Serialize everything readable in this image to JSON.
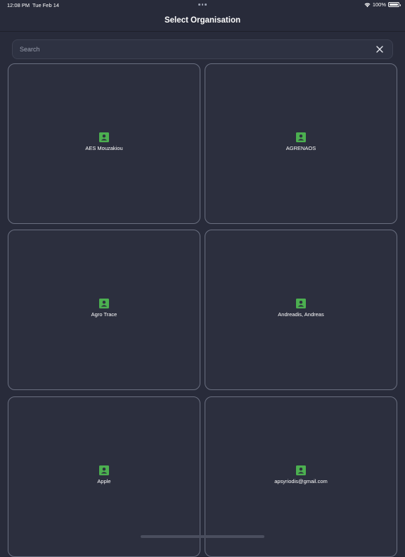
{
  "status_bar": {
    "time": "12:08 PM",
    "date": "Tue Feb 14",
    "battery": "100%",
    "wifi_icon": "wifi-icon",
    "battery_icon": "battery-icon"
  },
  "nav": {
    "title": "Select Organisation"
  },
  "search": {
    "placeholder": "Search",
    "value": "",
    "clear_icon": "close-icon"
  },
  "organisations": [
    {
      "name": "AES Mouzakiou",
      "icon": "contact-card-icon"
    },
    {
      "name": "AGRENAOS",
      "icon": "contact-card-icon"
    },
    {
      "name": "Agro Trace",
      "icon": "contact-card-icon"
    },
    {
      "name": "Andreadis, Andreas",
      "icon": "contact-card-icon"
    },
    {
      "name": "Apple",
      "icon": "contact-card-icon"
    },
    {
      "name": "apsyriodis@gmail.com",
      "icon": "contact-card-icon"
    }
  ],
  "colors": {
    "background": "#282b3a",
    "card_border": "#6a6f80",
    "accent_green": "#4caf50"
  }
}
